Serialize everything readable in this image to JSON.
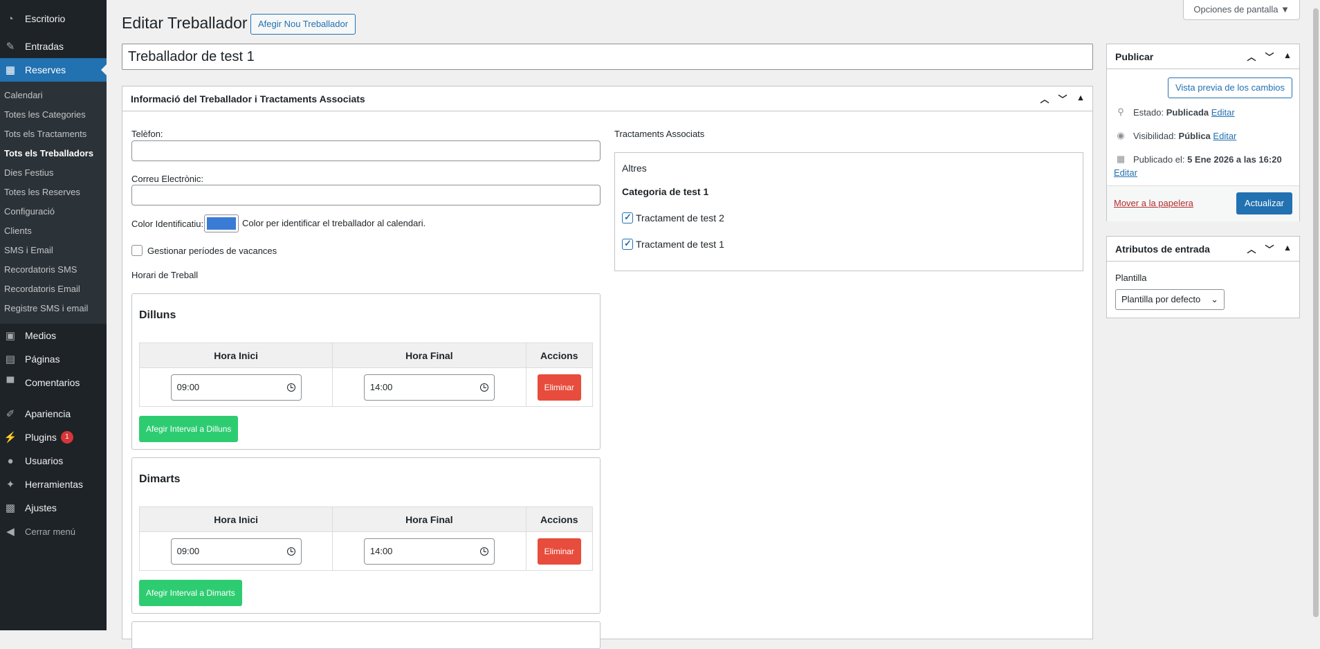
{
  "sidebar": {
    "top": [
      {
        "label": "Escritorio",
        "icon": "dashboard-icon"
      },
      {
        "label": "Entradas",
        "icon": "pin-icon"
      },
      {
        "label": "Reserves",
        "icon": "calendar-icon"
      }
    ],
    "submenu": [
      "Calendari",
      "Totes les Categories",
      "Tots els Tractaments",
      "Tots els Treballadors",
      "Dies Festius",
      "Totes les Reserves",
      "Configuració",
      "Clients",
      "SMS i Email",
      "Recordatoris SMS",
      "Recordatoris Email",
      "Registre SMS i email"
    ],
    "bottom": [
      {
        "label": "Medios",
        "icon": "media-icon"
      },
      {
        "label": "Páginas",
        "icon": "pages-icon"
      },
      {
        "label": "Comentarios",
        "icon": "comments-icon"
      },
      {
        "label": "Apariencia",
        "icon": "appearance-icon"
      },
      {
        "label": "Plugins",
        "icon": "plugins-icon",
        "badge": "1"
      },
      {
        "label": "Usuarios",
        "icon": "users-icon"
      },
      {
        "label": "Herramientas",
        "icon": "tools-icon"
      },
      {
        "label": "Ajustes",
        "icon": "settings-icon"
      }
    ],
    "collapse": "Cerrar menú"
  },
  "header": {
    "screen_options": "Opciones de pantalla ▼",
    "title": "Editar Treballador",
    "add_new": "Afegir Nou Treballador"
  },
  "post_title": "Treballador de test 1",
  "main_box": {
    "title": "Informació del Treballador i Tractaments Associats",
    "phone_label": "Telèfon:",
    "email_label": "Correu Electrònic:",
    "color_label": "Color Identificatiu:",
    "color_help": "Color per identificar el treballador al calendari.",
    "color_value": "#3a7bd5",
    "vacation_label": "Gestionar períodes de vacances",
    "schedule_label": "Horari de Treball",
    "days": [
      {
        "name": "Dilluns",
        "start": "09:00",
        "end": "14:00",
        "add": "Afegir Interval a Dilluns"
      },
      {
        "name": "Dimarts",
        "start": "09:00",
        "end": "14:00",
        "add": "Afegir Interval a Dimarts"
      }
    ],
    "table_headers": [
      "Hora Inici",
      "Hora Final",
      "Accions"
    ],
    "delete_label": "Eliminar",
    "treatments": {
      "title": "Tractaments Associats",
      "group": "Altres",
      "category": "Categoria de test 1",
      "items": [
        "Tractament de test 2",
        "Tractament de test 1"
      ]
    }
  },
  "publish": {
    "title": "Publicar",
    "preview": "Vista previa de los cambios",
    "status_label": "Estado:",
    "status_value": "Publicada",
    "visibility_label": "Visibilidad:",
    "visibility_value": "Pública",
    "published_label": "Publicado el:",
    "published_value": "5 Ene 2026 a las 16:20",
    "edit": "Editar",
    "trash": "Mover a la papelera",
    "update": "Actualizar"
  },
  "attributes": {
    "title": "Atributos de entrada",
    "template_label": "Plantilla",
    "template_value": "Plantilla por defecto"
  }
}
